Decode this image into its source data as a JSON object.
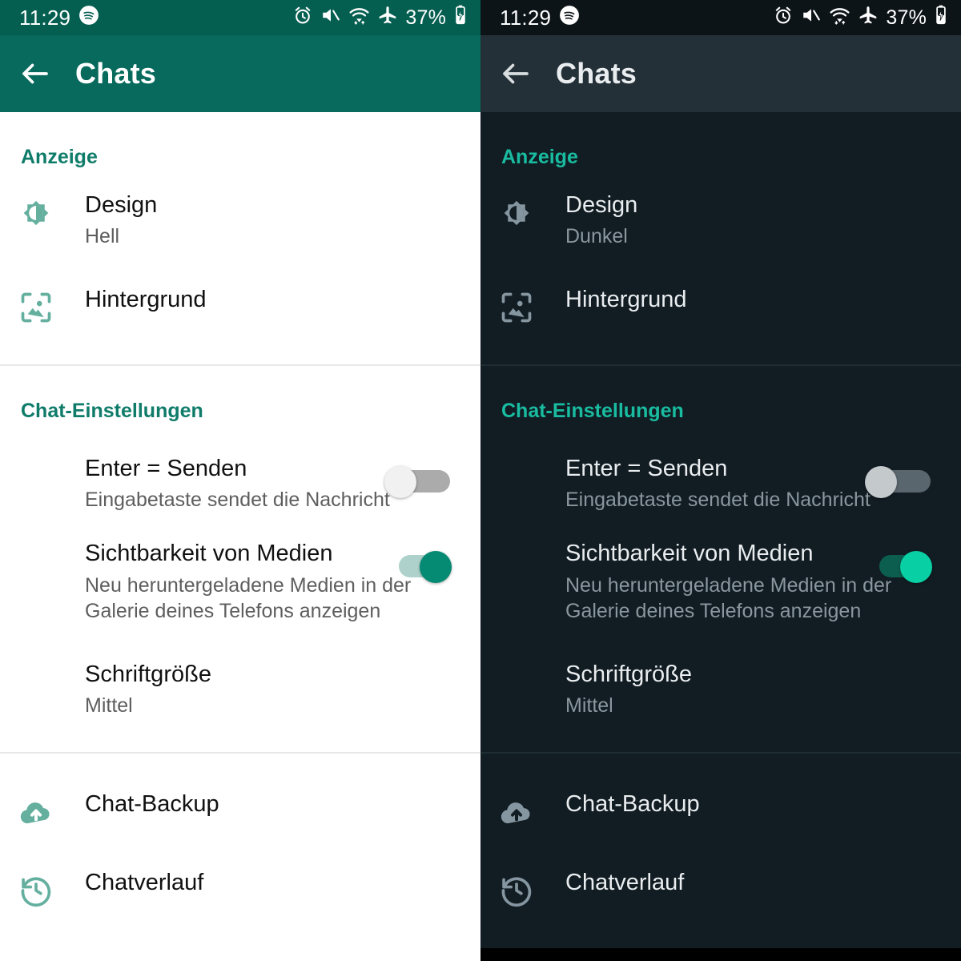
{
  "statusbar": {
    "time": "11:29",
    "battery_percent": "37%",
    "icons": [
      "spotify-icon",
      "alarm-icon",
      "mute-icon",
      "wifi-icon",
      "airplane-mode-icon",
      "battery-charging-icon"
    ]
  },
  "appbar": {
    "title": "Chats",
    "back_label": "back-arrow"
  },
  "sections": {
    "display": {
      "title": "Anzeige",
      "items": [
        {
          "title": "Design",
          "subtitle_light": "Hell",
          "subtitle_dark": "Dunkel",
          "icon": "brightness-icon"
        },
        {
          "title": "Hintergrund",
          "subtitle": "",
          "icon": "wallpaper-icon"
        }
      ]
    },
    "chat_settings": {
      "title": "Chat-Einstellungen",
      "items": [
        {
          "title": "Enter = Senden",
          "subtitle": "Eingabetaste sendet die Nachricht",
          "toggle": "off"
        },
        {
          "title": "Sichtbarkeit von Medien",
          "subtitle": "Neu heruntergeladene Medien in der\nGalerie deines Telefons anzeigen",
          "toggle": "on"
        },
        {
          "title": "Schriftgröße",
          "subtitle": "Mittel"
        }
      ]
    },
    "backup": {
      "items": [
        {
          "title": "Chat-Backup",
          "icon": "cloud-upload-icon"
        },
        {
          "title": "Chatverlauf",
          "icon": "history-icon"
        }
      ]
    }
  },
  "themes": {
    "light": {
      "name": "light",
      "statusbar_bg": "#055F51",
      "appbar_bg": "#076A5C",
      "content_bg": "#ffffff",
      "accent": "#0F7C6A",
      "icon": "#64AF9E",
      "title_text": "#111111",
      "sub_text": "#5E5E5E"
    },
    "dark": {
      "name": "dark",
      "statusbar_bg": "#0D1418",
      "appbar_bg": "#243038",
      "content_bg": "#111C23",
      "accent": "#19BCA0",
      "icon": "#8696A0",
      "title_text": "#E9EDEF",
      "sub_text": "#8A979E"
    }
  }
}
